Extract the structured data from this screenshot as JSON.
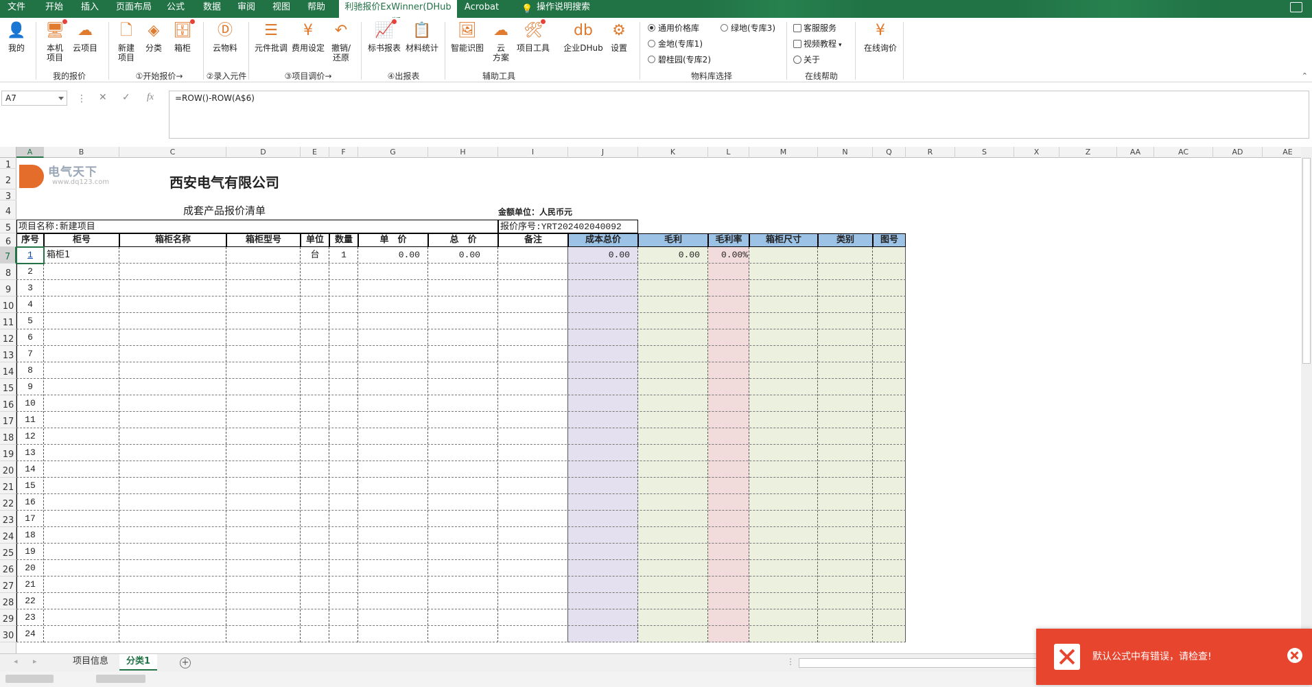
{
  "menu": {
    "items": [
      "文件",
      "开始",
      "插入",
      "页面布局",
      "公式",
      "数据",
      "审阅",
      "视图",
      "帮助",
      "利驰报价ExWinner(DHub版)",
      "Acrobat",
      "操作说明搜索"
    ],
    "active_index": 9
  },
  "ribbon": {
    "buttons": [
      "我的",
      "本机\n项目",
      "云项目",
      "新建\n项目",
      "分类",
      "箱柜",
      "云物料",
      "元件批调",
      "费用设定",
      "撤销/\n还原",
      "标书报表",
      "材料统计",
      "智能识图",
      "云\n方案",
      "项目工具",
      "企业DHub",
      "设置",
      "在线询价"
    ],
    "groups": [
      "我的报价",
      "①开始报价→",
      "②录入元件",
      "③项目调价→",
      "④出报表",
      "辅助工具",
      "物料库选择",
      "在线帮助"
    ],
    "library_options": [
      {
        "label": "通用价格库",
        "selected": true
      },
      {
        "label": "绿地(专库3)",
        "selected": false
      },
      {
        "label": "金地(专库1)",
        "selected": false
      },
      {
        "label": "碧桂园(专库2)",
        "selected": false
      }
    ],
    "help_items": [
      "客服服务",
      "视频教程",
      "关于"
    ]
  },
  "formula_bar": {
    "name_box": "A7",
    "formula": "=ROW()-ROW(A$6)"
  },
  "sheet": {
    "columns": [
      "A",
      "B",
      "C",
      "D",
      "E",
      "F",
      "G",
      "H",
      "I",
      "J",
      "K",
      "L",
      "M",
      "N",
      "Q",
      "R",
      "S",
      "X",
      "Z",
      "AA",
      "AC",
      "AD",
      "AE"
    ],
    "selected_column": "A",
    "selected_row": 7,
    "logo_text": "电气天下",
    "logo_url_text": "www.dq123.com",
    "company": "西安电气有限公司",
    "doc_title": "成套产品报价清单",
    "currency_label": "金额单位：人民币元",
    "project_name": "项目名称:新建项目",
    "quote_no": "报价序号:YRT202402040092",
    "headers": [
      "序号",
      "柜号",
      "箱柜名称",
      "箱柜型号",
      "单位",
      "数量",
      "单　价",
      "总　价",
      "备注",
      "成本总价",
      "毛利",
      "毛利率",
      "箱柜尺寸",
      "类别",
      "图号"
    ],
    "first_row": {
      "index": "1",
      "cabinet_no": "箱柜1",
      "unit": "台",
      "qty": "1",
      "unit_price": "0.00",
      "total_price": "0.00",
      "cost_total": "0.00",
      "gross_profit": "0.00",
      "gross_margin": "0.00%"
    },
    "seq_numbers": [
      "2",
      "3",
      "4",
      "5",
      "6",
      "7",
      "8",
      "9",
      "10",
      "11",
      "12",
      "13",
      "14",
      "15",
      "16",
      "17",
      "18",
      "19",
      "20",
      "21",
      "22",
      "23",
      "24"
    ],
    "row_numbers": [
      "1",
      "2",
      "3",
      "4",
      "5",
      "6",
      "7",
      "8",
      "9",
      "10",
      "11",
      "12",
      "13",
      "14",
      "15",
      "16",
      "17",
      "18",
      "19",
      "20",
      "21",
      "22",
      "23",
      "24",
      "25",
      "26",
      "27",
      "28",
      "29",
      "30"
    ]
  },
  "colors": {
    "accent": "#217346",
    "header_blue": "#9cc2e5",
    "cost_purple": "#e4e0f0",
    "profit_green": "#ebf1de",
    "margin_pink": "#f2dcdb",
    "toast_red": "#e8452f"
  },
  "tabs": {
    "items": [
      "项目信息",
      "分类1"
    ],
    "active_index": 1
  },
  "toast": {
    "message": "默认公式中有错误，请检查!"
  }
}
